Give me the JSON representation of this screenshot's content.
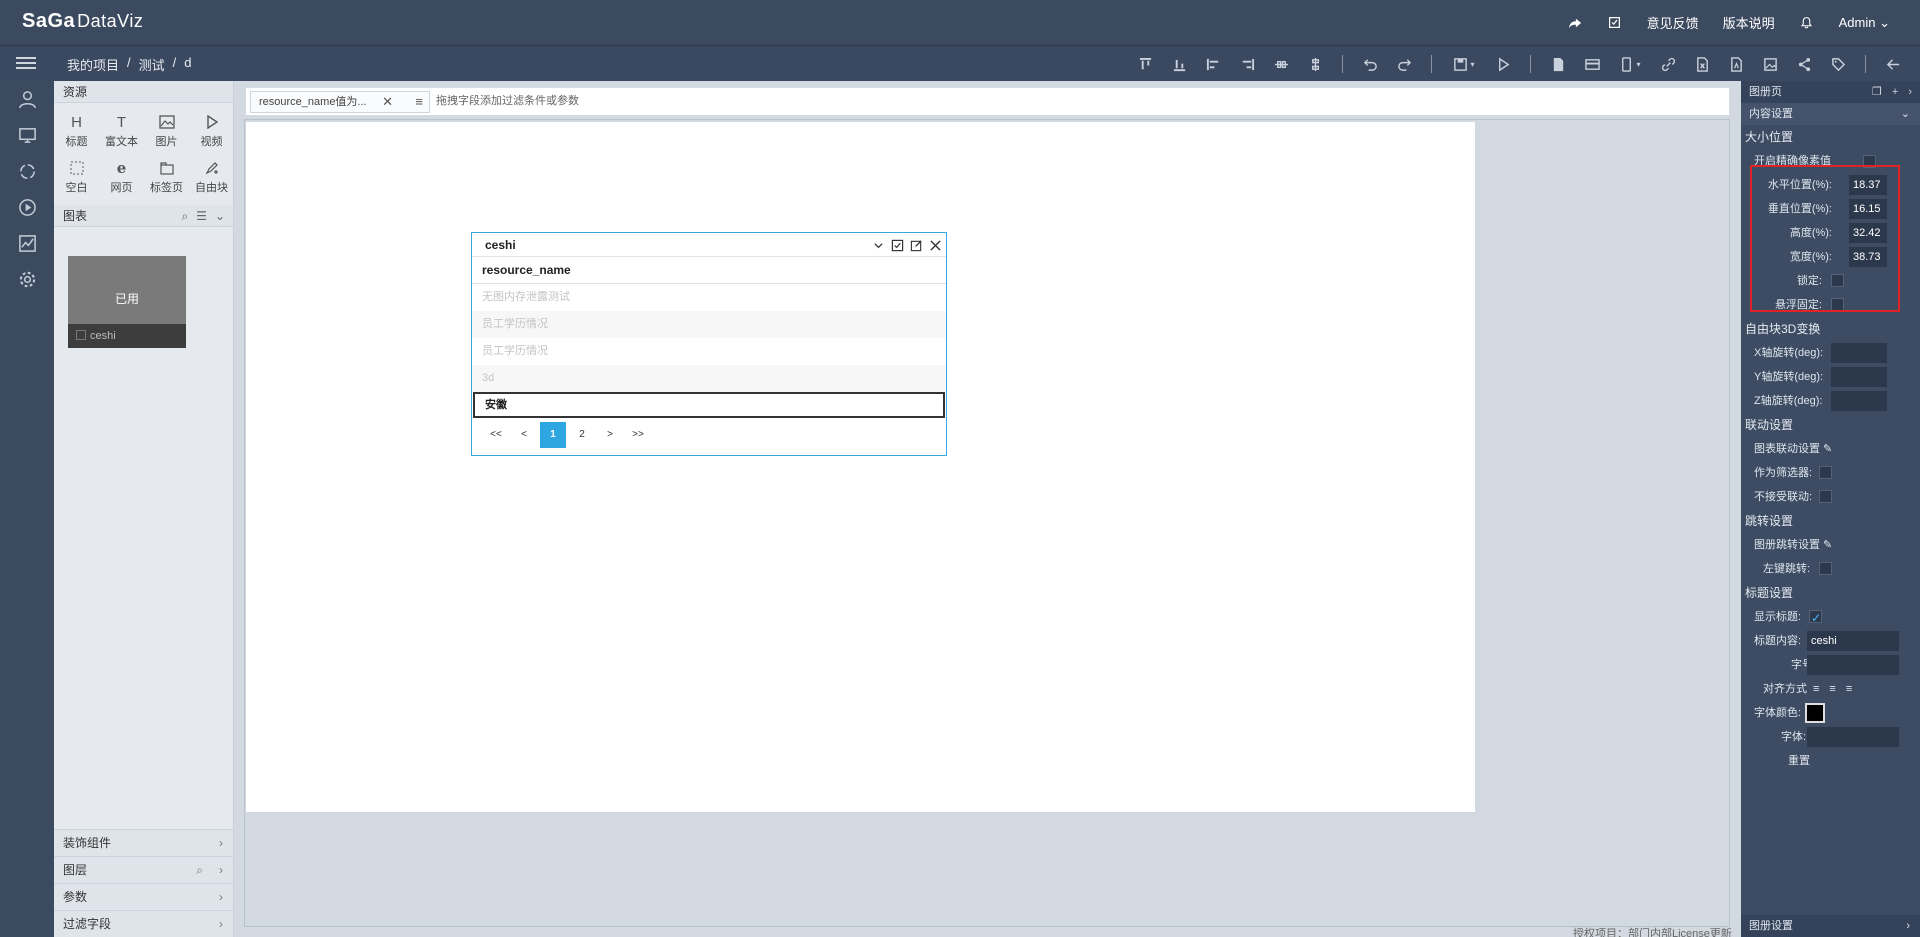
{
  "app": {
    "logo": "SaGa",
    "logo_suffix": "DataViz"
  },
  "topbar": {
    "feedback": "意见反馈",
    "release_notes": "版本说明",
    "user": "Admin"
  },
  "breadcrumb": {
    "items": [
      "我的项目",
      "测试",
      "d"
    ],
    "sep": "/"
  },
  "resources": {
    "title": "资源",
    "items": [
      {
        "label": "标题",
        "icon": "H"
      },
      {
        "label": "富文本",
        "icon": "T"
      },
      {
        "label": "图片",
        "icon": "image-icon"
      },
      {
        "label": "视频",
        "icon": "play-icon"
      },
      {
        "label": "空白",
        "icon": "blank-icon"
      },
      {
        "label": "网页",
        "icon": "e"
      },
      {
        "label": "标签页",
        "icon": "tab-icon"
      },
      {
        "label": "自由块",
        "icon": "pen-icon"
      }
    ],
    "charts_title": "图表",
    "chart_thumb": {
      "status": "已用",
      "name": "ceshi"
    },
    "groups": [
      "装饰组件",
      "图层",
      "参数",
      "过滤字段"
    ]
  },
  "filterbar": {
    "tab_label": "resource_name值为...",
    "hint": "拖拽字段添加过滤条件或参数"
  },
  "widget": {
    "title": "ceshi",
    "column": "resource_name",
    "rows": [
      "无图内存泄露测试",
      "员工学历情况",
      "员工学历情况",
      "3d",
      "安徽"
    ],
    "pager": [
      "<<",
      "<",
      "1",
      "2",
      ">",
      ">>"
    ],
    "current_page": "1"
  },
  "license": "授权项目：部门内部License更新",
  "props": {
    "head": "图册页",
    "content_settings": "内容设置",
    "size_position": "大小位置",
    "precise_pixel": "开启精确像素值",
    "h_pos_label": "水平位置(%):",
    "h_pos": "18.37",
    "v_pos_label": "垂直位置(%):",
    "v_pos": "16.15",
    "height_label": "高度(%):",
    "height": "32.42",
    "width_label": "宽度(%):",
    "width": "38.73",
    "lock": "锁定:",
    "float_fix": "悬浮固定:",
    "transform3d": "自由块3D变换",
    "x_rot": "X轴旋转(deg):",
    "y_rot": "Y轴旋转(deg):",
    "z_rot": "Z轴旋转(deg):",
    "linkage": "联动设置",
    "chart_linkage": "图表联动设置",
    "as_filter": "作为筛选器:",
    "no_linkage": "不接受联动:",
    "jump": "跳转设置",
    "album_jump": "图册跳转设置",
    "left_click_jump": "左键跳转:",
    "title_settings": "标题设置",
    "show_title": "显示标题:",
    "title_content_label": "标题内容:",
    "title_content": "ceshi",
    "font_size": "字号",
    "align": "对齐方式",
    "font_color": "字体颜色:",
    "font": "字体:",
    "reset": "重置",
    "album_settings": "图册设置"
  }
}
